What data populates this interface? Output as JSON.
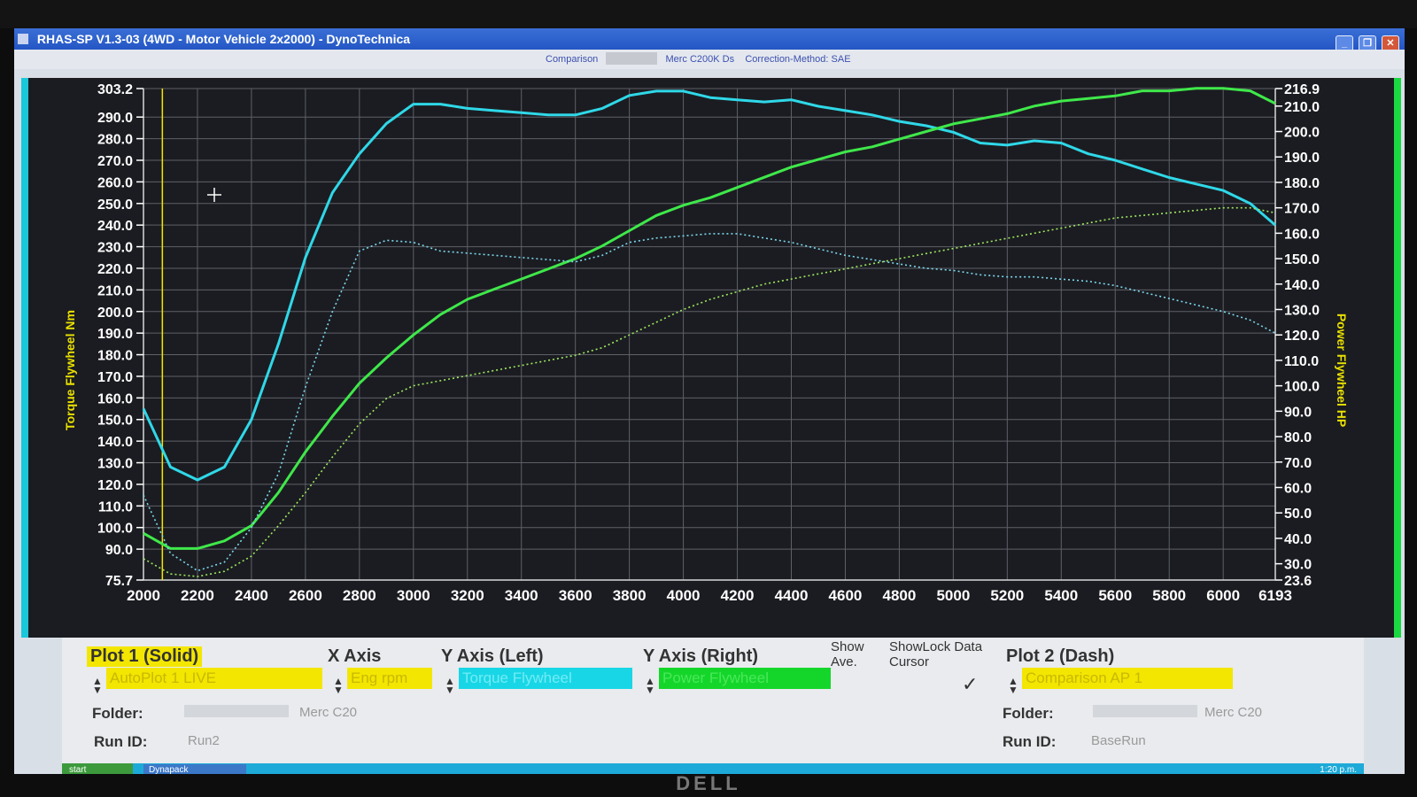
{
  "window": {
    "title": "RHAS-SP V1.3-03  (4WD - Motor Vehicle 2x2000) - DynoTechnica",
    "buttons": [
      "_",
      "❐",
      "✕"
    ]
  },
  "header": {
    "comparison_label": "Comparison",
    "run_name": "Merc C200K Ds",
    "correction": "Correction-Method: SAE"
  },
  "chart_data": {
    "type": "line",
    "xlabel": "",
    "ylabel_left": "Torque Flywheel Nm",
    "ylabel_right": "Power Flywheel HP",
    "xlim": [
      2000,
      6193
    ],
    "ylim_left": [
      75.7,
      303.2
    ],
    "ylim_right": [
      23.6,
      216.9
    ],
    "x_ticks": [
      "2000",
      "2200",
      "2400",
      "2600",
      "2800",
      "3000",
      "3200",
      "3400",
      "3600",
      "3800",
      "4000",
      "4200",
      "4400",
      "4600",
      "4800",
      "5000",
      "5200",
      "5400",
      "5600",
      "5800",
      "6000",
      "6193"
    ],
    "y_left_ticks": [
      "303.2",
      "290.0",
      "280.0",
      "270.0",
      "260.0",
      "250.0",
      "240.0",
      "230.0",
      "220.0",
      "210.0",
      "200.0",
      "190.0",
      "180.0",
      "170.0",
      "160.0",
      "150.0",
      "140.0",
      "130.0",
      "120.0",
      "110.0",
      "100.0",
      "90.0",
      "75.7"
    ],
    "y_right_ticks": [
      "216.9",
      "210.0",
      "200.0",
      "190.0",
      "180.0",
      "170.0",
      "160.0",
      "150.0",
      "140.0",
      "130.0",
      "120.0",
      "110.0",
      "100.0",
      "90.0",
      "80.0",
      "70.0",
      "60.0",
      "50.0",
      "40.0",
      "30.0",
      "23.6"
    ],
    "grid": true,
    "cursor_x": 2070,
    "series": [
      {
        "name": "Torque Flywheel",
        "axis": "left",
        "style": "solid",
        "color": "#2fd8e8",
        "x": [
          2000,
          2100,
          2200,
          2300,
          2400,
          2500,
          2600,
          2700,
          2800,
          2900,
          3000,
          3100,
          3200,
          3300,
          3400,
          3500,
          3600,
          3700,
          3800,
          3900,
          4000,
          4100,
          4200,
          4300,
          4400,
          4500,
          4600,
          4700,
          4800,
          4900,
          5000,
          5100,
          5200,
          5300,
          5400,
          5500,
          5600,
          5700,
          5800,
          5900,
          6000,
          6100,
          6193
        ],
        "y": [
          155,
          128,
          122,
          128,
          150,
          185,
          225,
          255,
          273,
          287,
          296,
          296,
          294,
          293,
          292,
          291,
          291,
          294,
          300,
          302,
          302,
          299,
          298,
          297,
          298,
          295,
          293,
          291,
          288,
          286,
          283,
          278,
          277,
          279,
          278,
          273,
          270,
          266,
          262,
          259,
          256,
          250,
          240
        ]
      },
      {
        "name": "Power Flywheel",
        "axis": "right",
        "style": "solid",
        "color": "#3fe84a",
        "x": [
          2000,
          2100,
          2200,
          2300,
          2400,
          2500,
          2600,
          2700,
          2800,
          2900,
          3000,
          3100,
          3200,
          3300,
          3400,
          3500,
          3600,
          3700,
          3800,
          3900,
          4000,
          4100,
          4200,
          4300,
          4400,
          4500,
          4600,
          4700,
          4800,
          4900,
          5000,
          5100,
          5200,
          5300,
          5400,
          5500,
          5600,
          5700,
          5800,
          5900,
          6000,
          6100,
          6193
        ],
        "y": [
          42,
          36,
          36,
          39,
          45,
          58,
          74,
          88,
          101,
          111,
          120,
          128,
          134,
          138,
          142,
          146,
          150,
          155,
          161,
          167,
          171,
          174,
          178,
          182,
          186,
          189,
          192,
          194,
          197,
          200,
          203,
          205,
          207,
          210,
          212,
          213,
          214,
          216,
          216,
          217,
          217,
          216,
          211
        ]
      },
      {
        "name": "Comparison Torque",
        "axis": "left",
        "style": "dash",
        "color": "#7ad8ee",
        "x": [
          2000,
          2100,
          2200,
          2300,
          2400,
          2500,
          2600,
          2700,
          2800,
          2900,
          3000,
          3100,
          3200,
          3300,
          3400,
          3500,
          3600,
          3700,
          3800,
          3900,
          4000,
          4100,
          4200,
          4300,
          4400,
          4500,
          4600,
          4700,
          4800,
          4900,
          5000,
          5100,
          5200,
          5300,
          5400,
          5500,
          5600,
          5700,
          5800,
          5900,
          6000,
          6100,
          6193
        ],
        "y": [
          115,
          88,
          80,
          84,
          100,
          125,
          165,
          200,
          228,
          233,
          232,
          228,
          227,
          226,
          225,
          224,
          223,
          226,
          232,
          234,
          235,
          236,
          236,
          234,
          232,
          229,
          226,
          224,
          222,
          220,
          219,
          217,
          216,
          216,
          215,
          214,
          212,
          209,
          206,
          203,
          200,
          196,
          190
        ]
      },
      {
        "name": "Comparison Power",
        "axis": "right",
        "style": "dash",
        "color": "#9ee860",
        "x": [
          2000,
          2100,
          2200,
          2300,
          2400,
          2500,
          2600,
          2700,
          2800,
          2900,
          3000,
          3100,
          3200,
          3300,
          3400,
          3500,
          3600,
          3700,
          3800,
          3900,
          4000,
          4100,
          4200,
          4300,
          4400,
          4500,
          4600,
          4700,
          4800,
          4900,
          5000,
          5100,
          5200,
          5300,
          5400,
          5500,
          5600,
          5700,
          5800,
          5900,
          6000,
          6100,
          6193
        ],
        "y": [
          32,
          26,
          25,
          27,
          33,
          45,
          58,
          72,
          85,
          95,
          100,
          102,
          104,
          106,
          108,
          110,
          112,
          115,
          120,
          125,
          130,
          134,
          137,
          140,
          142,
          144,
          146,
          148,
          150,
          152,
          154,
          156,
          158,
          160,
          162,
          164,
          166,
          167,
          168,
          169,
          170,
          170,
          168
        ]
      }
    ]
  },
  "panel": {
    "plot1_title": "Plot 1 (Solid)",
    "xaxis_title": "X Axis",
    "yleft_title": "Y Axis (Left)",
    "yright_title": "Y Axis (Right)",
    "show_ave": "Show Ave.",
    "show_lock": "ShowLock Data Cursor",
    "plot2_title": "Plot 2 (Dash)",
    "plot1_select": "AutoPlot 1 LIVE",
    "xaxis_select": "Eng rpm",
    "yleft_select": "Torque Flywheel",
    "yright_select": "Power Flywheel",
    "plot2_select": "Comparison AP 1",
    "checkmark": "✓",
    "folder_label": "Folder:",
    "folder1_value": "Merc C20",
    "folder2_value": "Merc C20",
    "runid_label": "Run ID:",
    "run1_value": "Run2",
    "run2_value": "BaseRun",
    "colors": {
      "yellow": "#f3e600",
      "cyan": "#19d6e6",
      "green": "#14d62a"
    }
  },
  "taskbar": {
    "start": "start",
    "item": "Dynapack",
    "clock": "1:20 p.m."
  },
  "monitor": {
    "brand": "DELL"
  }
}
